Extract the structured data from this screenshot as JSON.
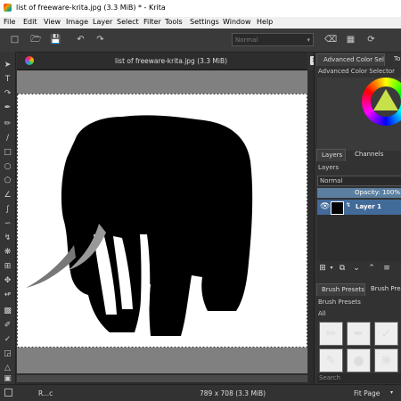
{
  "window": {
    "title": "list of freeware-krita.jpg (3.3 MiB) * - Krita"
  },
  "menu": [
    "File",
    "Edit",
    "View",
    "Image",
    "Layer",
    "Select",
    "Filter",
    "Tools",
    "Settings",
    "Window",
    "Help"
  ],
  "toolbar": {
    "blend_mode": "Normal"
  },
  "document": {
    "tab_title": "list of freeware-krita.jpg (3.3 MiB)"
  },
  "docker": {
    "color_tabs": [
      "Advanced Color Sel...",
      "To"
    ],
    "color_header": "Advanced Color Selector",
    "layer_tabs": [
      "Layers",
      "Channels"
    ],
    "layers_header": "Layers",
    "layer_mode": "Normal",
    "opacity_label": "Opacity: 100%",
    "layers": [
      {
        "name": "Layer 1"
      }
    ],
    "brush_tabs": [
      "Brush Presets",
      "Brush Prese"
    ],
    "brush_header": "Brush Presets",
    "brush_filter": "All",
    "search_placeholder": "Search"
  },
  "status": {
    "tool": "R...c",
    "dimensions": "789 x 708 (3.3 MiB)",
    "zoom": "Fit Page"
  },
  "colors": {
    "accent": "#426b9a",
    "canvas_bg": "#808080",
    "panel_bg": "#323232"
  }
}
